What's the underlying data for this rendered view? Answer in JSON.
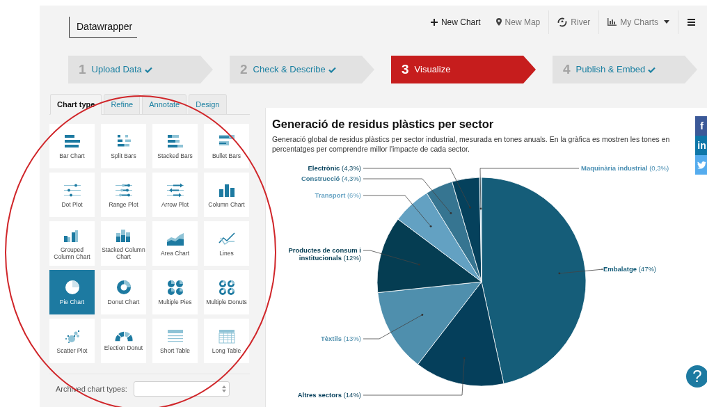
{
  "header": {
    "logo": "Datawrapper",
    "nav": [
      {
        "kind": "new-chart",
        "label": "New Chart"
      },
      {
        "kind": "new-map",
        "label": "New Map"
      },
      {
        "kind": "river",
        "label": "River"
      },
      {
        "kind": "my-charts",
        "label": "My Charts"
      },
      {
        "kind": "menu"
      }
    ]
  },
  "steps": [
    {
      "number": "1",
      "label": "Upload Data",
      "done": true,
      "selected": false
    },
    {
      "number": "2",
      "label": "Check & Describe",
      "done": true,
      "selected": false
    },
    {
      "number": "3",
      "label": "Visualize",
      "done": false,
      "selected": true
    },
    {
      "number": "4",
      "label": "Publish & Embed",
      "done": true,
      "selected": false
    }
  ],
  "tabs": [
    {
      "label": "Chart type",
      "selected": true
    },
    {
      "label": "Refine",
      "selected": false
    },
    {
      "label": "Annotate",
      "selected": false
    },
    {
      "label": "Design",
      "selected": false
    }
  ],
  "chart_types": [
    {
      "label": "Bar Chart",
      "kind": "bar",
      "selected": false
    },
    {
      "label": "Split Bars",
      "kind": "split",
      "selected": false
    },
    {
      "label": "Stacked Bars",
      "kind": "stacked",
      "selected": false
    },
    {
      "label": "Bullet Bars",
      "kind": "bullet",
      "selected": false
    },
    {
      "label": "Dot Plot",
      "kind": "dot",
      "selected": false
    },
    {
      "label": "Range Plot",
      "kind": "range",
      "selected": false
    },
    {
      "label": "Arrow Plot",
      "kind": "arrow",
      "selected": false
    },
    {
      "label": "Column Chart",
      "kind": "column",
      "selected": false
    },
    {
      "label": "Grouped Column Chart",
      "kind": "grouped",
      "selected": false
    },
    {
      "label": "Stacked Column Chart",
      "kind": "stackedcol",
      "selected": false
    },
    {
      "label": "Area Chart",
      "kind": "area",
      "selected": false
    },
    {
      "label": "Lines",
      "kind": "lines",
      "selected": false
    },
    {
      "label": "Pie Chart",
      "kind": "pie",
      "selected": true
    },
    {
      "label": "Donut Chart",
      "kind": "donut",
      "selected": false
    },
    {
      "label": "Multiple Pies",
      "kind": "pies",
      "selected": false
    },
    {
      "label": "Multiple Donuts",
      "kind": "donuts",
      "selected": false
    },
    {
      "label": "Scatter Plot",
      "kind": "scatter",
      "selected": false
    },
    {
      "label": "Election Donut",
      "kind": "election",
      "selected": false
    },
    {
      "label": "Short Table",
      "kind": "shorttable",
      "selected": false
    },
    {
      "label": "Long Table",
      "kind": "longtable",
      "selected": false
    }
  ],
  "archived": {
    "label": "Archived chart types:"
  },
  "chart": {
    "description": "Generació global de residus plàstics per sector industrial, mesurada en tones anuals. En la gràfica es mostren les tones en percentatges per comprendre millor l'impacte de cada sector.",
    "chart_data": {
      "type": "pie",
      "title": "Generació de residus plàstics per sector",
      "categories": [
        "Embalatge",
        "Altres sectors",
        "Tèxtils",
        "Productes de consum i institucionals",
        "Transport",
        "Construcció",
        "Electrònic",
        "Maquinària industrial"
      ],
      "values": [
        47,
        14,
        13,
        12,
        6,
        4.3,
        4.3,
        0.3
      ],
      "value_labels": [
        "(47%)",
        "(14%)",
        "(13%)",
        "(12%)",
        "(6%)",
        "(4,3%)",
        "(4,3%)",
        "(0,3%)"
      ],
      "colors": [
        "#155d79",
        "#053f5b",
        "#4f8fad",
        "#053d52",
        "#63a1c2",
        "#367591",
        "#05415c",
        "#8fc0d7"
      ]
    }
  },
  "share_buttons": [
    {
      "kind": "facebook",
      "label": "f"
    },
    {
      "kind": "linkedin",
      "label": "in"
    },
    {
      "kind": "twitter"
    }
  ],
  "help_button": "?"
}
